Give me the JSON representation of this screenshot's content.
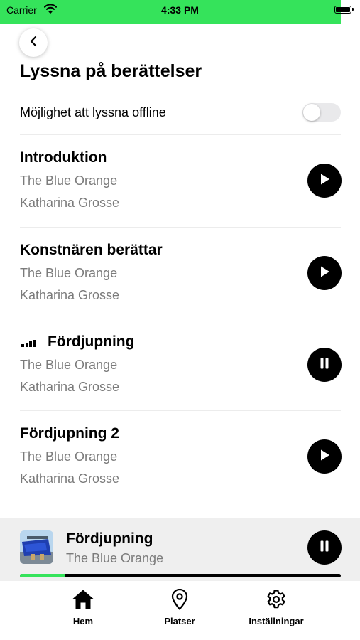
{
  "status_bar": {
    "carrier": "Carrier",
    "time": "4:33 PM",
    "accent_color": "#35e35b"
  },
  "header": {
    "back_icon": "chevron-left-icon",
    "title": "Lyssna på berättelser"
  },
  "offline": {
    "label": "Möjlighet att lyssna offline",
    "enabled": false
  },
  "tracks": [
    {
      "title": "Introduktion",
      "subtitle": "The Blue Orange",
      "artist": "Katharina Grosse",
      "state": "play",
      "now_playing": false
    },
    {
      "title": "Konstnären berättar",
      "subtitle": "The Blue Orange",
      "artist": "Katharina Grosse",
      "state": "play",
      "now_playing": false
    },
    {
      "title": "Fördjupning",
      "subtitle": "The Blue Orange",
      "artist": "Katharina Grosse",
      "state": "pause",
      "now_playing": true
    },
    {
      "title": "Fördjupning 2",
      "subtitle": "The Blue Orange",
      "artist": "Katharina Grosse",
      "state": "play",
      "now_playing": false
    }
  ],
  "mini_player": {
    "title": "Fördjupning",
    "subtitle": "The Blue Orange",
    "state": "pause",
    "progress": 0.14
  },
  "tabbar": [
    {
      "label": "Hem",
      "icon": "home-icon"
    },
    {
      "label": "Platser",
      "icon": "map-pin-icon"
    },
    {
      "label": "Inställningar",
      "icon": "gear-icon"
    }
  ]
}
